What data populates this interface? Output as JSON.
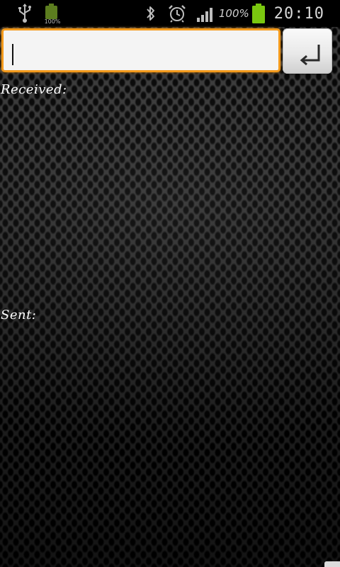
{
  "status_bar": {
    "small_battery_label": "100%",
    "battery_percent": "100%",
    "time": "20:10",
    "icons": [
      "usb-icon",
      "battery-icon",
      "bluetooth-icon",
      "alarm-icon",
      "signal-icon",
      "battery-icon"
    ]
  },
  "message_input": {
    "value": "",
    "placeholder": ""
  },
  "send_button": {
    "icon": "enter-icon"
  },
  "received": {
    "label": "Received:"
  },
  "sent": {
    "label": "Sent:"
  },
  "colors": {
    "accent": "#f39a1c",
    "battery_green": "#7ac70f",
    "background": "#141414"
  }
}
